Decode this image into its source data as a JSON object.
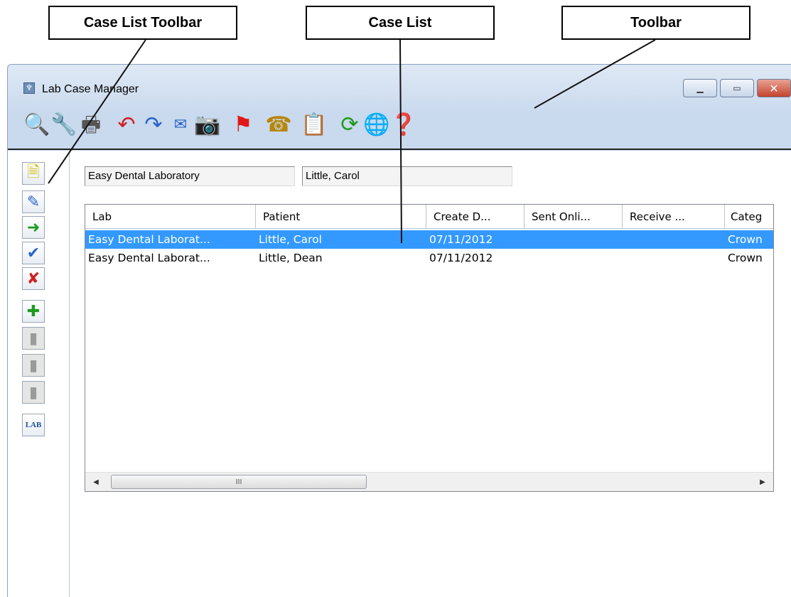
{
  "callouts": {
    "case_list_toolbar": "Case List Toolbar",
    "case_list": "Case List",
    "toolbar": "Toolbar"
  },
  "window": {
    "title": "Lab Case Manager",
    "app_icon": "tooth-icon",
    "buttons": [
      "minimize-icon",
      "restore-icon",
      "close-icon"
    ]
  },
  "toolbar": {
    "icons": [
      "magnifier-icon",
      "wrench-icon",
      "printer-icon",
      "send-icon",
      "receive-icon",
      "email-icon",
      "camera-icon",
      "flag-icon",
      "phone-icon",
      "clipboard-icon",
      "refresh-icon",
      "globe-icon",
      "help-icon"
    ]
  },
  "filters": {
    "lab": "Easy Dental Laboratory",
    "patient": "Little, Carol"
  },
  "case_list": {
    "columns": [
      "Lab",
      "Patient",
      "Create D...",
      "Sent Onli...",
      "Receive ...",
      "Categ"
    ],
    "rows": [
      {
        "lab": "Easy Dental Laborat...",
        "patient": "Little, Carol",
        "created": "07/11/2012",
        "sent": "",
        "received": "",
        "category": "Crown",
        "selected": true
      },
      {
        "lab": "Easy Dental Laborat...",
        "patient": "Little, Dean",
        "created": "07/11/2012",
        "sent": "",
        "received": "",
        "category": "Crown",
        "selected": false
      }
    ],
    "scroll_thumb_label": "III"
  },
  "case_list_toolbar": {
    "icons": [
      "new-case-icon",
      "edit-case-icon",
      "import-case-icon",
      "check-case-icon",
      "delete-case-icon",
      "add-case-icon",
      "disabled-icon",
      "disabled-icon",
      "disabled-icon",
      "lab-icon"
    ]
  },
  "colors": {
    "selection": "#3399ff",
    "title_bar": "#c9d9ee",
    "close_button": "#c4432d"
  }
}
